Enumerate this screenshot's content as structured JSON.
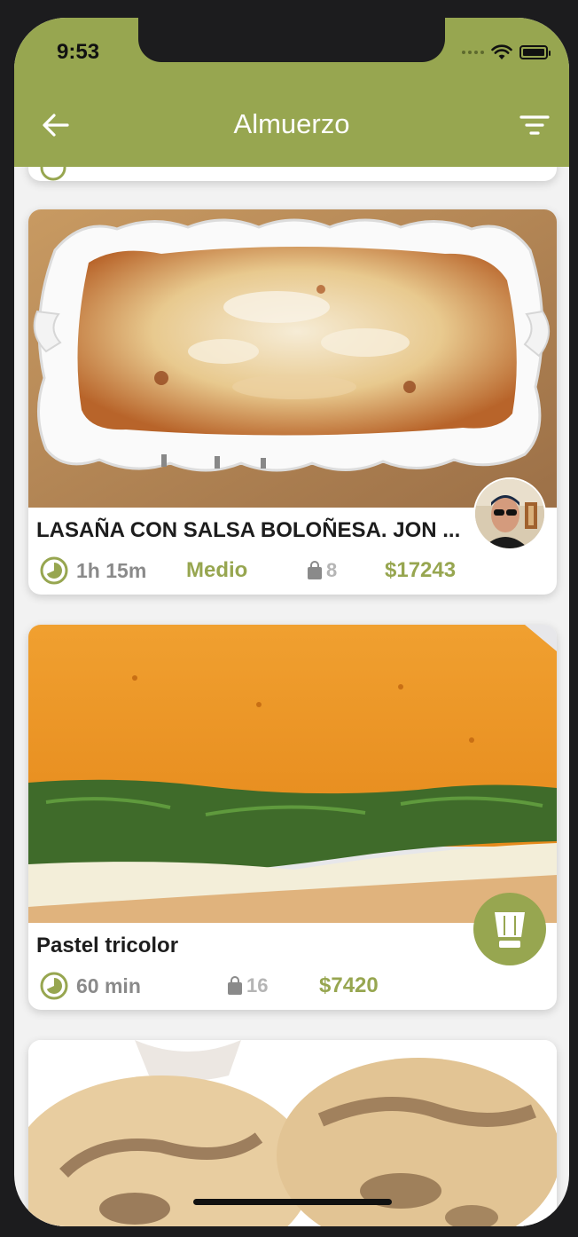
{
  "status_bar": {
    "time": "9:53"
  },
  "header": {
    "title": "Almuerzo"
  },
  "recipes": [
    {
      "title": "LASAÑA CON SALSA BOLOÑESA. JON ...",
      "time": "1h 15m",
      "level": "Medio",
      "ingredients": "8",
      "price": "$17243",
      "author": "avatar"
    },
    {
      "title": "Pastel tricolor",
      "time": "60 min",
      "level": "",
      "ingredients": "16",
      "price": "$7420",
      "author": "chef-hat-icon"
    }
  ],
  "colors": {
    "accent": "#97a650",
    "background": "#f2f2f2",
    "muted_text": "#8a8a8a"
  }
}
